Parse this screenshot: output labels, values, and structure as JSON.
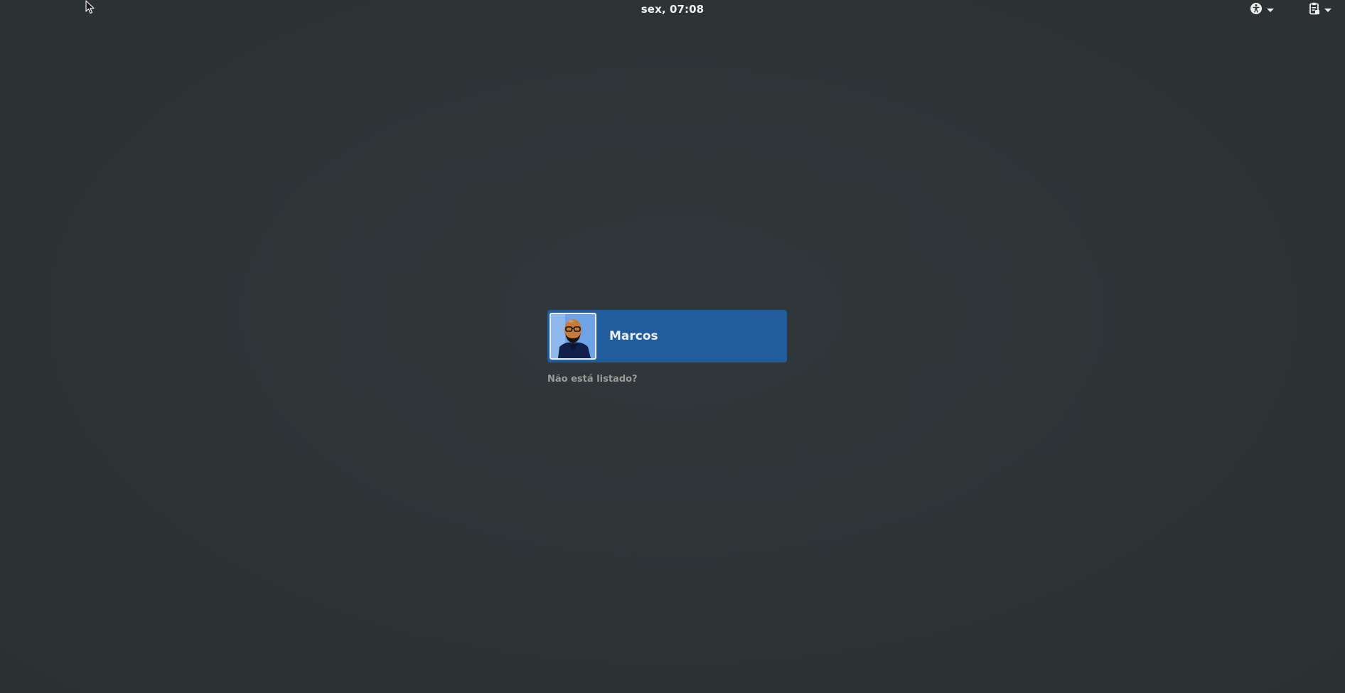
{
  "top_bar": {
    "clock": "sex, 07:08",
    "accessibility_icon": "accessibility-icon",
    "system_icon": "clipboard-icon"
  },
  "user_list": {
    "users": [
      {
        "name": "Marcos",
        "avatar_icon": "user-avatar"
      }
    ],
    "not_listed_label": "Não está listado?"
  },
  "colors": {
    "background": "#2e3436",
    "selected_user": "#215d9c",
    "text": "#eeeeec",
    "muted_text": "#9a9c98"
  }
}
